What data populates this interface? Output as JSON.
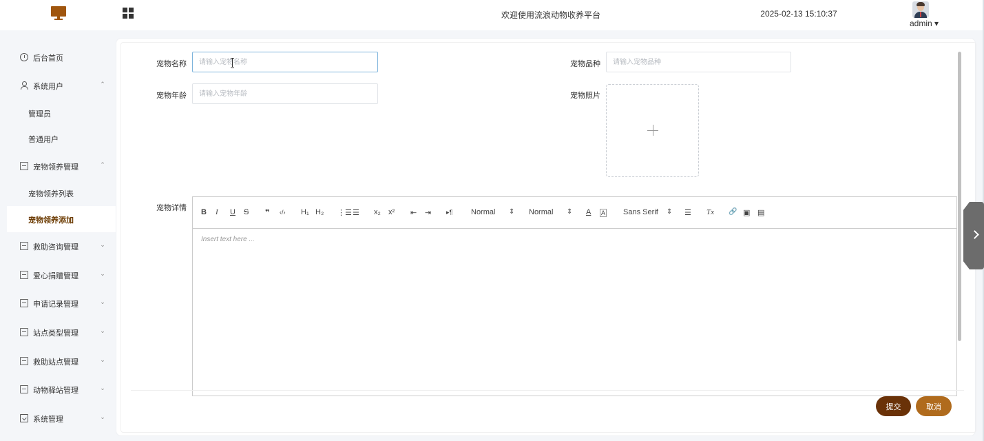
{
  "header": {
    "site_title": "欢迎使用流浪动物收养平台",
    "datetime": "2025-02-13 15:10:37",
    "user_name": "admin ▾",
    "logo_icon": "monitor-icon",
    "menu_toggle_icon": "grid-icon"
  },
  "sidebar": {
    "items": [
      {
        "label": "后台首页",
        "icon": "clock-icon"
      },
      {
        "label": "系统用户",
        "icon": "user-icon",
        "arrow": "⌃",
        "children": [
          "管理员",
          "普通用户"
        ]
      },
      {
        "label": "宠物领养管理",
        "icon": "box-icon",
        "arrow": "⌃",
        "children": [
          "宠物领养列表",
          "宠物领养添加"
        ]
      },
      {
        "label": "救助咨询管理",
        "icon": "box-icon",
        "arrow": "⌄"
      },
      {
        "label": "爱心捐赠管理",
        "icon": "box-icon",
        "arrow": "⌄"
      },
      {
        "label": "申请记录管理",
        "icon": "box-icon",
        "arrow": "⌄"
      },
      {
        "label": "站点类型管理",
        "icon": "box-icon",
        "arrow": "⌄"
      },
      {
        "label": "救助站点管理",
        "icon": "box-icon",
        "arrow": "⌄"
      },
      {
        "label": "动物驿站管理",
        "icon": "box-icon",
        "arrow": "⌄"
      },
      {
        "label": "系统管理",
        "icon": "folder-icon",
        "arrow": "⌄"
      }
    ],
    "sub": {
      "admin": "管理员",
      "normal_user": "普通用户",
      "pet_list": "宠物领养列表",
      "pet_add": "宠物领养添加"
    },
    "active_item": "宠物领养添加"
  },
  "form": {
    "pet_name": {
      "label": "宠物名称",
      "placeholder": "请输入宠物名称",
      "value": ""
    },
    "pet_breed": {
      "label": "宠物品种",
      "placeholder": "请输入宠物品种",
      "value": ""
    },
    "pet_age": {
      "label": "宠物年龄",
      "placeholder": "请输入宠物年龄",
      "value": ""
    },
    "pet_photo": {
      "label": "宠物照片",
      "icon": "plus-icon"
    },
    "pet_detail": {
      "label": "宠物详情",
      "placeholder": "Insert text here ..."
    }
  },
  "editor_toolbar": {
    "bold": "B",
    "italic": "I",
    "underline": "U",
    "strike": "S",
    "blockquote": "❞",
    "code": "‹/›",
    "h1": "H₁",
    "h2": "H₂",
    "ordered_list": "⋮☰",
    "bullet_list": "☰",
    "subscript": "x₂",
    "superscript": "x²",
    "indent_decrease": "⇤",
    "indent_increase": "⇥",
    "direction": "▸¶",
    "size_select": "Normal",
    "header_select": "Normal",
    "color": "A",
    "background": "A",
    "font_select": "Sans Serif",
    "align": "☰",
    "clean": "Tx",
    "link": "🔗",
    "image": "▣",
    "video": "▤"
  },
  "buttons": {
    "submit": "提交",
    "cancel": "取消"
  },
  "colors": {
    "brand": "#a0560e",
    "submit": "#6a3208",
    "cancel": "#b06b1d",
    "active_text": "#6b3a00"
  }
}
